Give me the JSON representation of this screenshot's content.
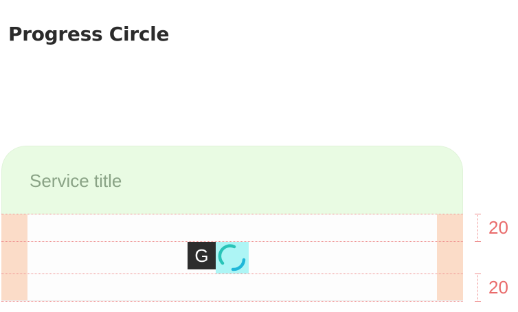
{
  "page": {
    "title": "Progress Circle"
  },
  "card": {
    "service_title": "Service title"
  },
  "progress": {
    "badge_label": "G",
    "icon": "progress-circle-icon"
  },
  "spacing": {
    "top_label": "20",
    "bottom_label": "20"
  },
  "colors": {
    "header_background": "#e9fbe3",
    "padding_highlight": "#fbdcc8",
    "spinner_background": "#adf5f5",
    "spinner_arc_primary": "#1fb7d9",
    "spinner_arc_secondary": "#29c4b8",
    "guide_color": "#ee8b8b",
    "badge_background": "#2d2d2d"
  }
}
